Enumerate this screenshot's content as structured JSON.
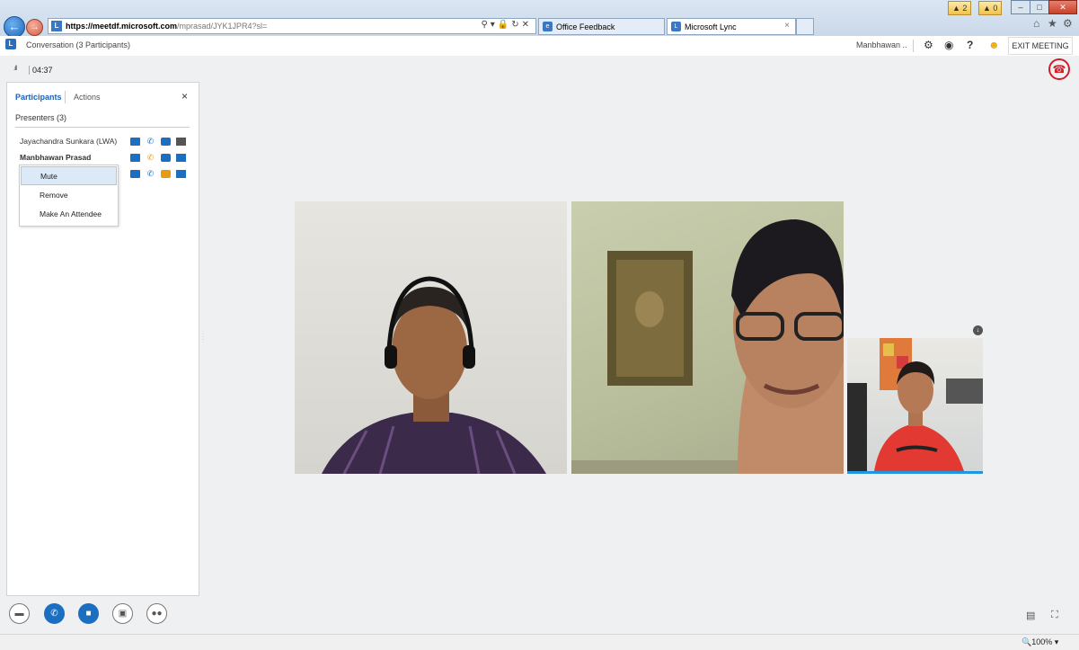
{
  "browser": {
    "url_host": "https://meetdf.microsoft.com",
    "url_path": "/mprasad/JYK1JPR4?sl=",
    "tabs": [
      {
        "label": "Office Feedback"
      },
      {
        "label": "Microsoft Lync",
        "close": "×"
      }
    ],
    "badge_a": "2",
    "badge_b": "0",
    "zoom": "100%"
  },
  "header": {
    "title": "Conversation (3 Participants)",
    "user": "Manbhawan ..",
    "exit_label": "EXIT MEETING"
  },
  "status": {
    "timer": "04:37"
  },
  "panel": {
    "tab_participants": "Participants",
    "tab_actions": "Actions",
    "close": "×",
    "section": "Presenters (3)",
    "participants": [
      {
        "name": "Jayachandra Sunkara (LWA)"
      },
      {
        "name": "Manbhawan Prasad"
      }
    ],
    "menu": [
      "Mute",
      "Remove",
      "Make An Attendee"
    ]
  },
  "colors": {
    "accent": "#1b6fc1",
    "hangup": "#d21e2b",
    "active_speaker": "#2196e0",
    "presence_orange": "#e59b14"
  }
}
